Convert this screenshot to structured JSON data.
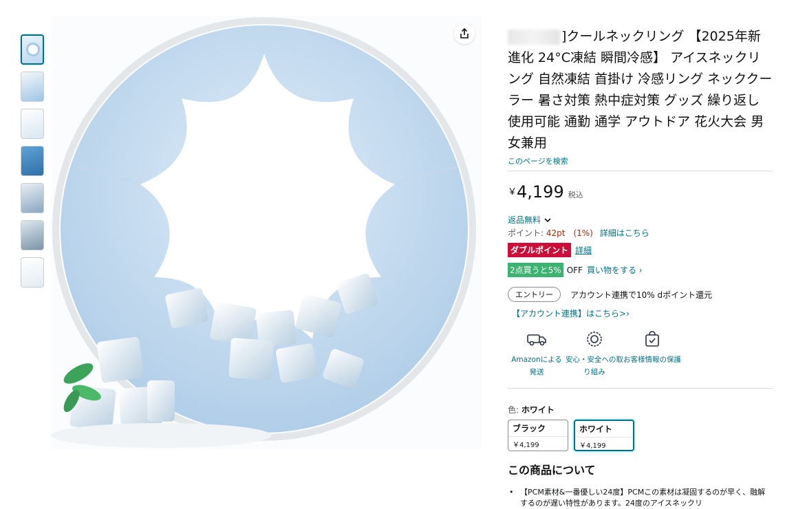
{
  "thumbnails": [
    {
      "label": "thumbnail-1",
      "selected": true
    },
    {
      "label": "thumbnail-2",
      "selected": false
    },
    {
      "label": "thumbnail-3",
      "selected": false
    },
    {
      "label": "thumbnail-4",
      "selected": false
    },
    {
      "label": "thumbnail-5",
      "selected": false
    },
    {
      "label": "thumbnail-6",
      "selected": false
    },
    {
      "label": "thumbnail-7",
      "selected": false
    }
  ],
  "product": {
    "title_bracket": "]",
    "title": "クールネックリング 【2025年新進化 24°C凍結 瞬間冷感】 アイスネックリング 自然凍結 首掛け 冷感リング ネッククーラー 暑さ対策 熱中症対策 グッズ 繰り返し使用可能 通勤 通学 アウトドア 花火大会 男女兼用",
    "search_link": "このページを検索"
  },
  "price": {
    "symbol": "￥",
    "value": "4,199",
    "tax": "税込"
  },
  "returns": {
    "label": "返品無料"
  },
  "points": {
    "prefix": "ポイント: ",
    "amount": "42pt　(1%)",
    "link": "詳細はこちら"
  },
  "double_point": {
    "badge": "ダブルポイント",
    "link": "詳細"
  },
  "bundle": {
    "badge": "2点買うと5%",
    "off": "OFF",
    "link": "買い物をする ›"
  },
  "entry": {
    "pill": "エントリー",
    "desc": "アカウント連携で10% dポイント還元",
    "account_link": "【アカウント連携】はこちら>›"
  },
  "features": [
    {
      "icon": "truck-icon",
      "label": "Amazonによる発送"
    },
    {
      "icon": "safety-badge-icon",
      "label": "安心・安全への取り組み"
    },
    {
      "icon": "secure-bag-icon",
      "label": "お客様情報の保護"
    }
  ],
  "color": {
    "label": "色: ",
    "selected": "ホワイト",
    "options": [
      {
        "name": "ブラック",
        "price": "￥4,199",
        "selected": false
      },
      {
        "name": "ホワイト",
        "price": "￥4,199",
        "selected": true
      }
    ]
  },
  "about": {
    "heading": "この商品について",
    "bullet": "【PCM素材&一番優しい24度】PCMこの素材は凝固するのが早く、融解するのが遅い特性があります。24度のアイスネックリ"
  },
  "colors": {
    "link": "#007185",
    "double_badge": "#cc0c39",
    "bundle_badge": "#3cb371",
    "price_points": "#b12704"
  }
}
